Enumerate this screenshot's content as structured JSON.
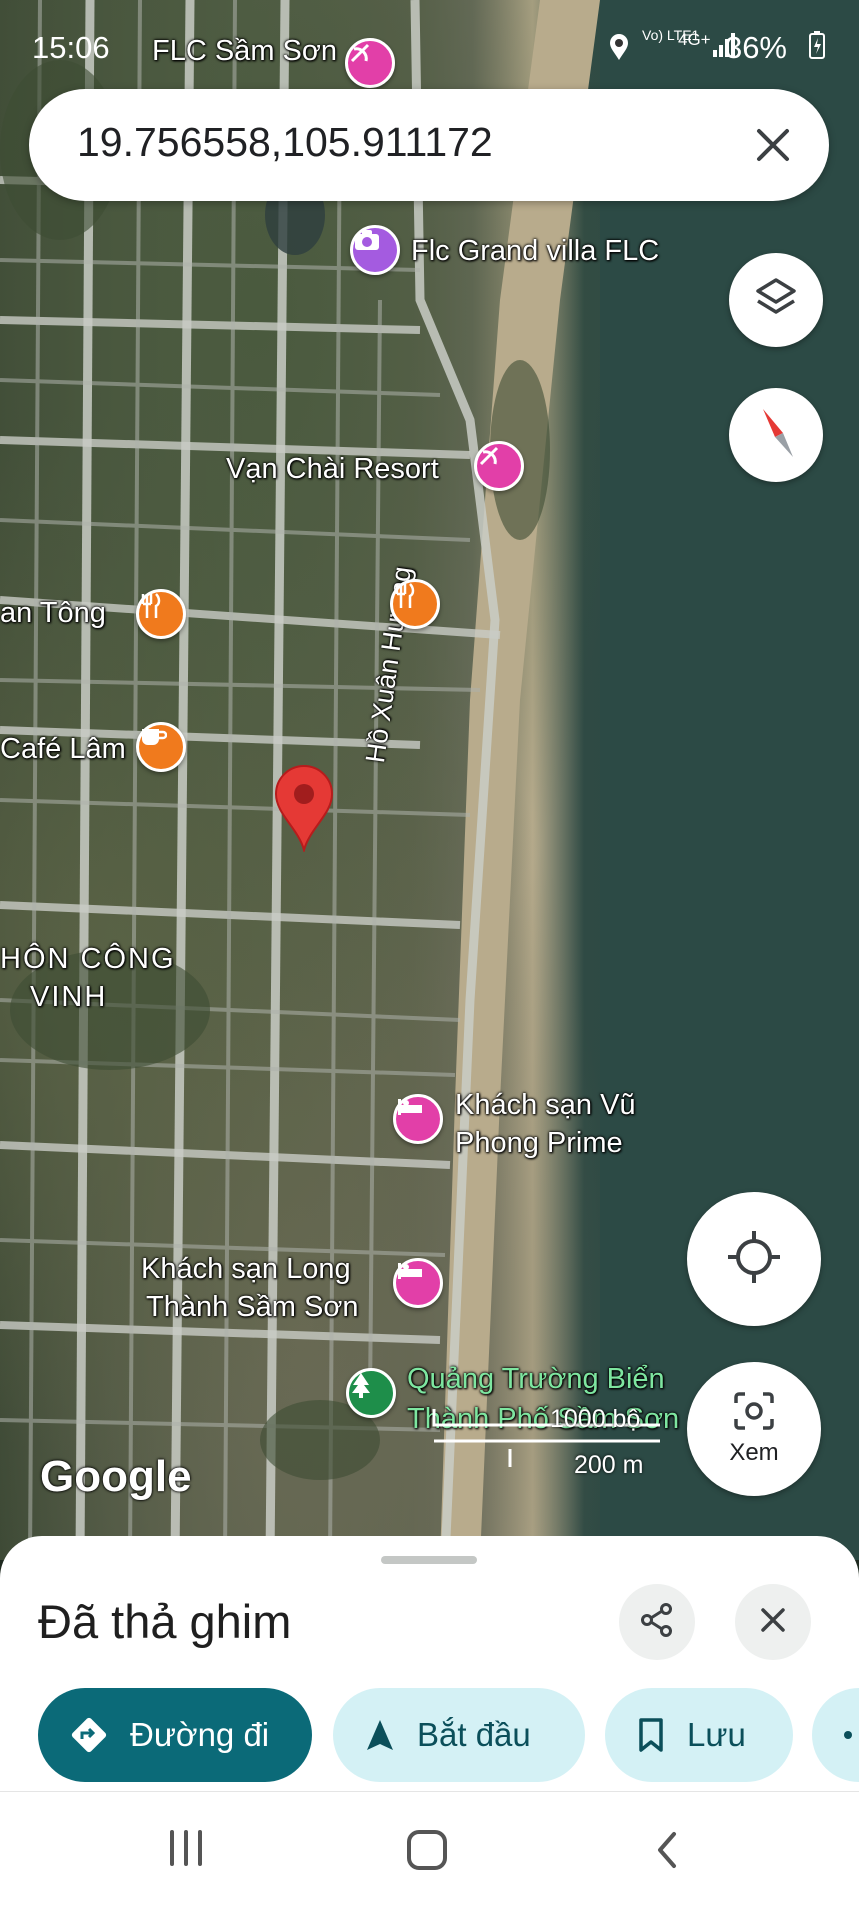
{
  "status_bar": {
    "time": "15:06",
    "battery": "36%",
    "network": "4G+",
    "volte": "Vo) LTE1"
  },
  "search": {
    "value": "19.756558,105.911172",
    "clear_icon": "close-icon"
  },
  "map": {
    "labels": [
      {
        "text": "FLC Sầm Sơn",
        "style": "white"
      },
      {
        "text": "Flc Grand villa FLC",
        "style": "white"
      },
      {
        "text": "Vạn Chài Resort",
        "style": "white"
      },
      {
        "text": "an Tông",
        "style": "white"
      },
      {
        "text": "Café Lâm",
        "style": "white"
      },
      {
        "text": "Hồ Xuân Hương",
        "style": "white"
      },
      {
        "text": "HÔN CÔNG",
        "style": "white"
      },
      {
        "text": "VINH",
        "style": "white"
      },
      {
        "text": "Khách sạn Vũ",
        "style": "white"
      },
      {
        "text": "Phong Prime",
        "style": "white"
      },
      {
        "text": "Khách sạn Long",
        "style": "white"
      },
      {
        "text": "Thành Sầm Sơn",
        "style": "white"
      },
      {
        "text": "Quảng Trường Biển",
        "style": "green"
      },
      {
        "text": "Thành Phố Sầm Sơn",
        "style": "green"
      }
    ],
    "scale_top": "1000 bộ",
    "scale_bottom": "200 m",
    "logo": "Google",
    "lens_label": "Xem",
    "colors": {
      "pin": "#e53935",
      "hotel_poi": "#e23fa8",
      "restaurant_poi": "#f07a1d",
      "photo_poi": "#a45be0",
      "park_poi": "#1e8e4a"
    }
  },
  "sheet": {
    "title": "Đã thả ghim",
    "share_icon": "share-icon",
    "close_icon": "close-icon",
    "chips": [
      {
        "label": "Đường đi",
        "icon": "directions-icon"
      },
      {
        "label": "Bắt đầu",
        "icon": "navigation-arrow-icon"
      },
      {
        "label": "Lưu",
        "icon": "bookmark-icon"
      }
    ],
    "accent_color": "#0b6a78"
  }
}
